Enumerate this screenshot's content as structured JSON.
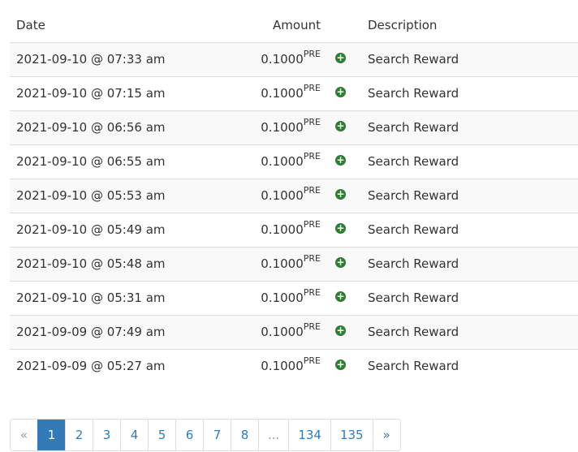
{
  "table": {
    "headers": {
      "date": "Date",
      "amount": "Amount",
      "description": "Description"
    },
    "rows": [
      {
        "date": "2021-09-10 @ 07:33 am",
        "amount": "0.1000",
        "unit": "PRE",
        "icon": "plus-circle-icon",
        "description": "Search Reward"
      },
      {
        "date": "2021-09-10 @ 07:15 am",
        "amount": "0.1000",
        "unit": "PRE",
        "icon": "plus-circle-icon",
        "description": "Search Reward"
      },
      {
        "date": "2021-09-10 @ 06:56 am",
        "amount": "0.1000",
        "unit": "PRE",
        "icon": "plus-circle-icon",
        "description": "Search Reward"
      },
      {
        "date": "2021-09-10 @ 06:55 am",
        "amount": "0.1000",
        "unit": "PRE",
        "icon": "plus-circle-icon",
        "description": "Search Reward"
      },
      {
        "date": "2021-09-10 @ 05:53 am",
        "amount": "0.1000",
        "unit": "PRE",
        "icon": "plus-circle-icon",
        "description": "Search Reward"
      },
      {
        "date": "2021-09-10 @ 05:49 am",
        "amount": "0.1000",
        "unit": "PRE",
        "icon": "plus-circle-icon",
        "description": "Search Reward"
      },
      {
        "date": "2021-09-10 @ 05:48 am",
        "amount": "0.1000",
        "unit": "PRE",
        "icon": "plus-circle-icon",
        "description": "Search Reward"
      },
      {
        "date": "2021-09-10 @ 05:31 am",
        "amount": "0.1000",
        "unit": "PRE",
        "icon": "plus-circle-icon",
        "description": "Search Reward"
      },
      {
        "date": "2021-09-09 @ 07:49 am",
        "amount": "0.1000",
        "unit": "PRE",
        "icon": "plus-circle-icon",
        "description": "Search Reward"
      },
      {
        "date": "2021-09-09 @ 05:27 am",
        "amount": "0.1000",
        "unit": "PRE",
        "icon": "plus-circle-icon",
        "description": "Search Reward"
      }
    ]
  },
  "pagination": {
    "prev": "«",
    "pages": [
      "1",
      "2",
      "3",
      "4",
      "5",
      "6",
      "7",
      "8"
    ],
    "ellipsis": "...",
    "last_pages": [
      "134",
      "135"
    ],
    "next": "»",
    "current": "1"
  },
  "colors": {
    "accent": "#337ab7",
    "plus_icon": "#2e7d32"
  }
}
